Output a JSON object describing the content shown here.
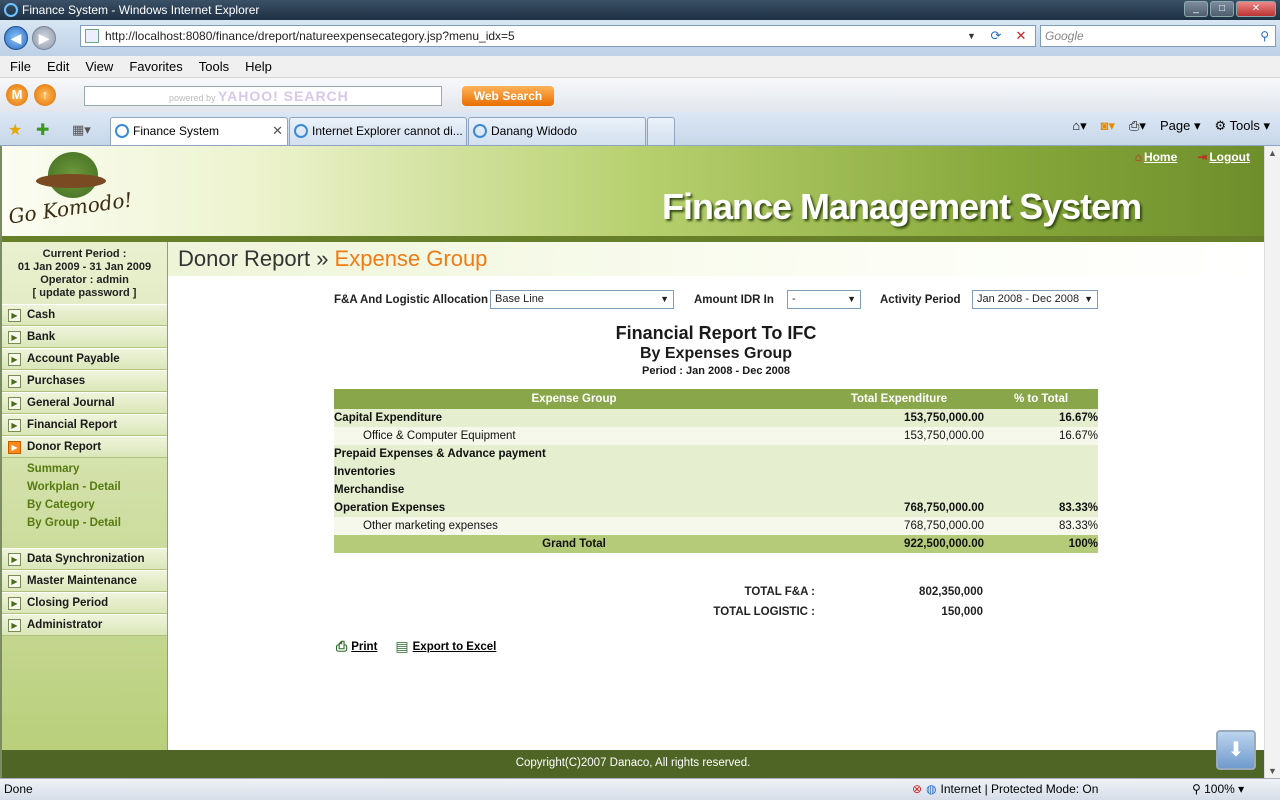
{
  "window": {
    "title": "Finance System - Windows Internet Explorer"
  },
  "browser": {
    "url": "http://localhost:8080/finance/dreport/natureexpensecategory.jsp?menu_idx=5",
    "search_placeholder": "Google",
    "menu": [
      "File",
      "Edit",
      "View",
      "Favorites",
      "Tools",
      "Help"
    ],
    "yahoo_placeholder": "powered by",
    "yahoo_brand": "YAHOO! SEARCH",
    "web_search": "Web Search",
    "tabs": [
      "Finance System",
      "Internet Explorer cannot di...",
      "Danang Widodo"
    ],
    "page_cmd": "Page",
    "tools_cmd": "Tools"
  },
  "header": {
    "logo_text": "Go Komodo!",
    "title": "Finance Management System",
    "home": "Home",
    "logout": "Logout"
  },
  "sidebar": {
    "period_label": "Current Period :",
    "period_value": "01 Jan 2009 - 31 Jan 2009",
    "operator": "Operator : admin",
    "update_password": "[ update password ]",
    "items_top": [
      "Cash",
      "Bank",
      "Account Payable",
      "Purchases",
      "General Journal",
      "Financial Report",
      "Donor Report"
    ],
    "subitems": [
      "Summary",
      "Workplan - Detail",
      "By Category",
      "By Group - Detail"
    ],
    "items_bottom": [
      "Data Synchronization",
      "Master Maintenance",
      "Closing Period",
      "Administrator"
    ]
  },
  "breadcrumb": {
    "parent": "Donor Report",
    "sep": " » ",
    "current": "Expense Group"
  },
  "filters": {
    "allocation_label": "F&A And Logistic Allocation",
    "allocation_value": "Base Line",
    "amount_label": "Amount IDR In",
    "amount_value": "-",
    "activity_label": "Activity Period",
    "activity_value": "Jan 2008 - Dec 2008"
  },
  "report": {
    "title": "Financial Report To IFC",
    "subtitle": "By Expenses Group",
    "period": "Period : Jan 2008 - Dec 2008",
    "headers": [
      "Expense Group",
      "Total Expenditure",
      "% to Total"
    ],
    "rows": [
      {
        "name": "Capital Expenditure",
        "total": "153,750,000.00",
        "pct": "16.67%"
      },
      {
        "name": "Office & Computer Equipment",
        "total": "153,750,000.00",
        "pct": "16.67%"
      },
      {
        "name": "Prepaid Expenses & Advance payment",
        "total": "",
        "pct": ""
      },
      {
        "name": "Inventories",
        "total": "",
        "pct": ""
      },
      {
        "name": "Merchandise",
        "total": "",
        "pct": ""
      },
      {
        "name": "Operation Expenses",
        "total": "768,750,000.00",
        "pct": "83.33%"
      },
      {
        "name": "Other marketing expenses",
        "total": "768,750,000.00",
        "pct": "83.33%"
      }
    ],
    "grand_total_label": "Grand Total",
    "grand_total": "922,500,000.00",
    "grand_pct": "100%",
    "total_fa_label": "TOTAL F&A :",
    "total_fa": "802,350,000",
    "total_logistic_label": "TOTAL LOGISTIC :",
    "total_logistic": "150,000"
  },
  "actions": {
    "print": "Print",
    "export": "Export to Excel"
  },
  "footer": {
    "copyright": "Copyright(C)2007 Danaco, All rights reserved."
  },
  "status": {
    "left": "Done",
    "zone": "Internet | Protected Mode: On",
    "zoom": "100%"
  }
}
